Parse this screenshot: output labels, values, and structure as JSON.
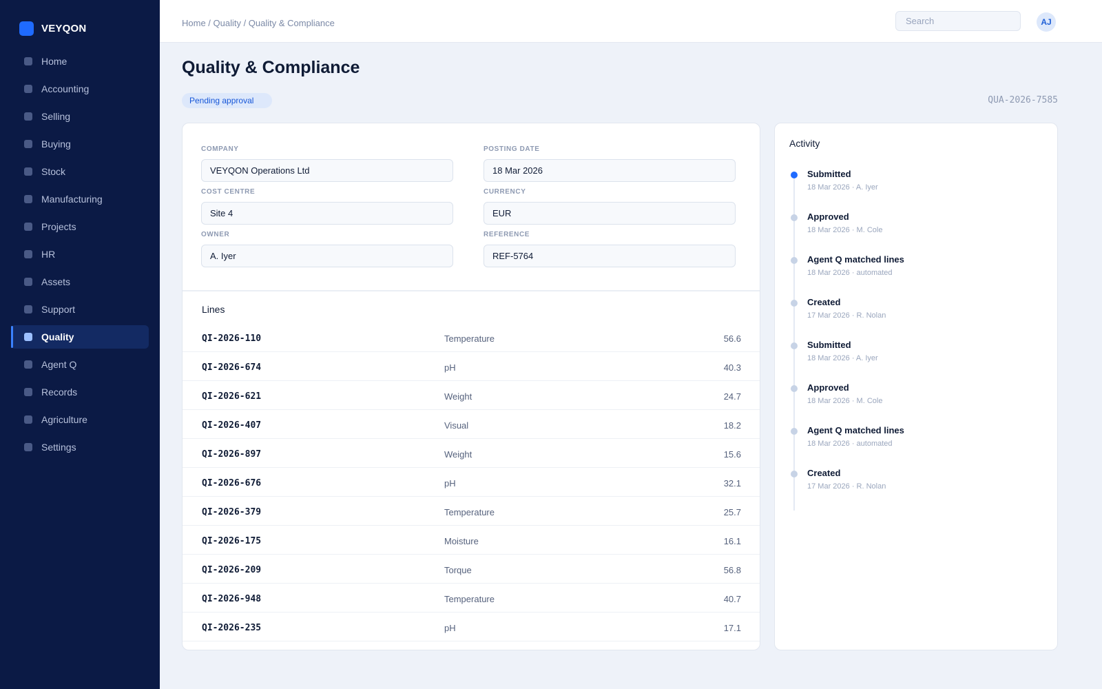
{
  "app": {
    "brand": "VEYQON"
  },
  "sidebar": {
    "items": [
      {
        "label": "Home"
      },
      {
        "label": "Accounting"
      },
      {
        "label": "Selling"
      },
      {
        "label": "Buying"
      },
      {
        "label": "Stock"
      },
      {
        "label": "Manufacturing"
      },
      {
        "label": "Projects"
      },
      {
        "label": "HR"
      },
      {
        "label": "Assets"
      },
      {
        "label": "Support"
      },
      {
        "label": "Quality",
        "active": true
      },
      {
        "label": "Agent Q"
      },
      {
        "label": "Records"
      },
      {
        "label": "Agriculture"
      },
      {
        "label": "Settings"
      }
    ]
  },
  "topbar": {
    "breadcrumb": "Home / Quality / Quality & Compliance",
    "search_placeholder": "Search",
    "search_value": "",
    "avatar_initials": "AJ"
  },
  "page": {
    "title": "Quality & Compliance",
    "status": "Pending approval",
    "doc_id": "QUA-2026-7585"
  },
  "form": {
    "company": {
      "label": "COMPANY",
      "value": "VEYQON Operations Ltd"
    },
    "posting_date": {
      "label": "POSTING DATE",
      "value": "18 Mar 2026"
    },
    "cost_centre": {
      "label": "COST CENTRE",
      "value": "Site 4"
    },
    "currency": {
      "label": "CURRENCY",
      "value": "EUR"
    },
    "owner": {
      "label": "OWNER",
      "value": "A. Iyer"
    },
    "reference": {
      "label": "REFERENCE",
      "value": "REF-5764"
    }
  },
  "lines": {
    "title": "Lines",
    "rows": [
      {
        "id": "QI-2026-110",
        "metric": "Temperature",
        "value": "56.6"
      },
      {
        "id": "QI-2026-674",
        "metric": "pH",
        "value": "40.3"
      },
      {
        "id": "QI-2026-621",
        "metric": "Weight",
        "value": "24.7"
      },
      {
        "id": "QI-2026-407",
        "metric": "Visual",
        "value": "18.2"
      },
      {
        "id": "QI-2026-897",
        "metric": "Weight",
        "value": "15.6"
      },
      {
        "id": "QI-2026-676",
        "metric": "pH",
        "value": "32.1"
      },
      {
        "id": "QI-2026-379",
        "metric": "Temperature",
        "value": "25.7"
      },
      {
        "id": "QI-2026-175",
        "metric": "Moisture",
        "value": "16.1"
      },
      {
        "id": "QI-2026-209",
        "metric": "Torque",
        "value": "56.8"
      },
      {
        "id": "QI-2026-948",
        "metric": "Temperature",
        "value": "40.7"
      },
      {
        "id": "QI-2026-235",
        "metric": "pH",
        "value": "17.1"
      }
    ]
  },
  "activity": {
    "title": "Activity",
    "events": [
      {
        "event": "Submitted",
        "meta": "18 Mar 2026 · A. Iyer",
        "current": true
      },
      {
        "event": "Approved",
        "meta": "18 Mar 2026 · M. Cole"
      },
      {
        "event": "Agent Q matched lines",
        "meta": "18 Mar 2026 · automated"
      },
      {
        "event": "Created",
        "meta": "17 Mar 2026 · R. Nolan"
      },
      {
        "event": "Submitted",
        "meta": "18 Mar 2026 · A. Iyer"
      },
      {
        "event": "Approved",
        "meta": "18 Mar 2026 · M. Cole"
      },
      {
        "event": "Agent Q matched lines",
        "meta": "18 Mar 2026 · automated"
      },
      {
        "event": "Created",
        "meta": "17 Mar 2026 · R. Nolan"
      }
    ]
  }
}
